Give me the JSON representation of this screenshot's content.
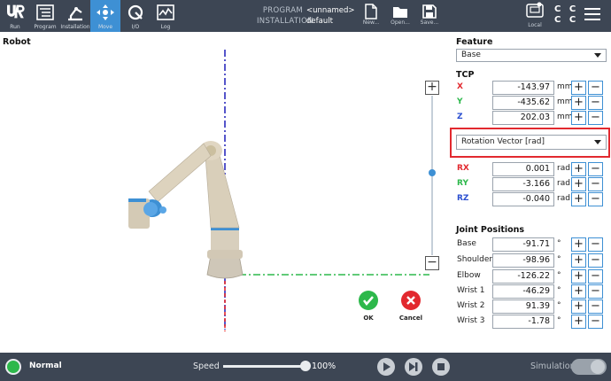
{
  "nav": {
    "items": [
      {
        "label": "Run"
      },
      {
        "label": "Program"
      },
      {
        "label": "Installation"
      },
      {
        "label": "Move"
      },
      {
        "label": "I/O"
      },
      {
        "label": "Log"
      }
    ]
  },
  "program_info": {
    "program_key": "PROGRAM",
    "program_value": "<unnamed>",
    "installation_key": "INSTALLATION",
    "installation_value": "default"
  },
  "file_buttons": {
    "new": "New...",
    "open": "Open...",
    "save": "Save..."
  },
  "local": {
    "label": "Local"
  },
  "ccc": {
    "row1": "C C",
    "row2": "C C"
  },
  "robot": {
    "title": "Robot"
  },
  "actions": {
    "ok": "OK",
    "cancel": "Cancel"
  },
  "feature": {
    "title": "Feature",
    "selected": "Base"
  },
  "tcp": {
    "title": "TCP",
    "rows": [
      {
        "name": "X",
        "value": "-143.97",
        "unit": "mm",
        "color": "#e2292f"
      },
      {
        "name": "Y",
        "value": "-435.62",
        "unit": "mm",
        "color": "#2db84b"
      },
      {
        "name": "Z",
        "value": "202.03",
        "unit": "mm",
        "color": "#2b4fd0"
      }
    ],
    "rotation_selected": "Rotation Vector [rad]",
    "rot_rows": [
      {
        "name": "RX",
        "value": "0.001",
        "unit": "rad",
        "color": "#e2292f"
      },
      {
        "name": "RY",
        "value": "-3.166",
        "unit": "rad",
        "color": "#2db84b"
      },
      {
        "name": "RZ",
        "value": "-0.040",
        "unit": "rad",
        "color": "#2b4fd0"
      }
    ]
  },
  "joints": {
    "title": "Joint Positions",
    "rows": [
      {
        "name": "Base",
        "value": "-91.71",
        "unit": "°"
      },
      {
        "name": "Shoulder",
        "value": "-98.96",
        "unit": "°"
      },
      {
        "name": "Elbow",
        "value": "-126.22",
        "unit": "°"
      },
      {
        "name": "Wrist 1",
        "value": "-46.29",
        "unit": "°"
      },
      {
        "name": "Wrist 2",
        "value": "91.39",
        "unit": "°"
      },
      {
        "name": "Wrist 3",
        "value": "-1.78",
        "unit": "°"
      }
    ]
  },
  "bottom": {
    "status": "Normal",
    "speed_label": "Speed",
    "speed_value": "100%",
    "speed_fraction": 1.0,
    "simulation_label": "Simulation"
  },
  "pm": {
    "plus": "+",
    "minus": "−"
  },
  "colors": {
    "accent": "#3e90d4",
    "topbar": "#3d4654",
    "highlight": "#e2292f",
    "status_ok": "#2db84b"
  }
}
